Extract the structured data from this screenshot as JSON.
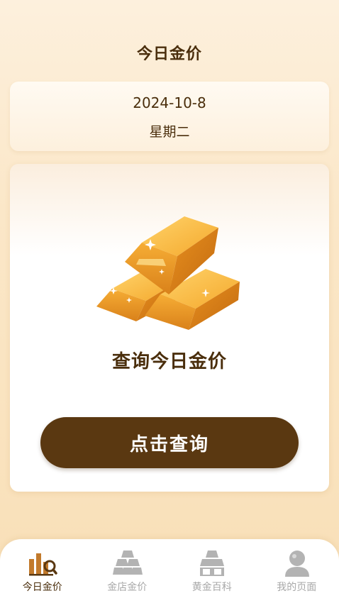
{
  "header": {
    "title": "今日金价"
  },
  "date_card": {
    "date": "2024-10-8",
    "weekday": "星期二"
  },
  "main_card": {
    "heading": "查询今日金价",
    "button_label": "点击查询"
  },
  "tab_bar": {
    "items": [
      {
        "label": "今日金价",
        "icon": "bar-chart-magnifier-icon",
        "active": true
      },
      {
        "label": "金店金价",
        "icon": "gold-bars-stack-icon",
        "active": false
      },
      {
        "label": "黄金百科",
        "icon": "gold-encyclopedia-icon",
        "active": false
      },
      {
        "label": "我的页面",
        "icon": "user-profile-icon",
        "active": false
      }
    ]
  },
  "colors": {
    "accent_brown": "#5a3811",
    "text_brown": "#4a2e0c",
    "inactive_gray": "#a8a8a8",
    "gold": "#f2a52a"
  }
}
